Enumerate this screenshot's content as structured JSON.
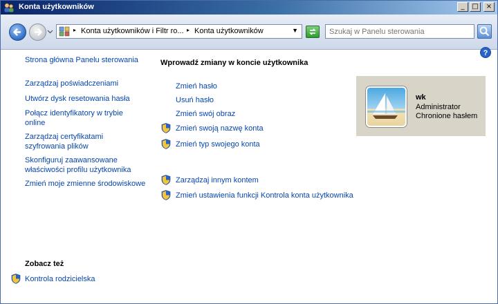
{
  "window": {
    "title": "Konta użytkowników",
    "min_glyph": "_",
    "max_glyph": "□",
    "close_glyph": "×"
  },
  "navbar": {
    "breadcrumb": [
      "Konta użytkowników i Filtr ro...",
      "Konta użytkowników"
    ],
    "search_placeholder": "Szukaj w Panelu sterowania"
  },
  "left_nav": {
    "items": [
      "Strona główna Panelu sterowania",
      "Zarządzaj poświadczeniami",
      "Utwórz dysk resetowania hasła",
      "Połącz identyfikatory w trybie online",
      "Zarządzaj certyfikatami szyfrowania plików",
      "Skonfiguruj zaawansowane właściwości profilu użytkownika",
      "Zmień moje zmienne środowiskowe"
    ],
    "see_also_title": "Zobacz też",
    "see_also_items": [
      "Kontrola rodzicielska"
    ]
  },
  "main": {
    "title": "Wprowadź zmiany w koncie użytkownika",
    "tasks": [
      "Zmień hasło",
      "Usuń hasło",
      "Zmień swój obraz",
      "Zmień swoją nazwę konta",
      "Zmień typ swojego konta",
      "Zarządzaj innym kontem",
      "Zmień ustawienia funkcji Kontrola konta użytkownika"
    ]
  },
  "user": {
    "name": "wk",
    "role": "Administrator",
    "status": "Chronione hasłem"
  },
  "colors": {
    "link": "#0645ad",
    "titlebar": "#0a246a",
    "user_card": "#d8d4c8"
  }
}
